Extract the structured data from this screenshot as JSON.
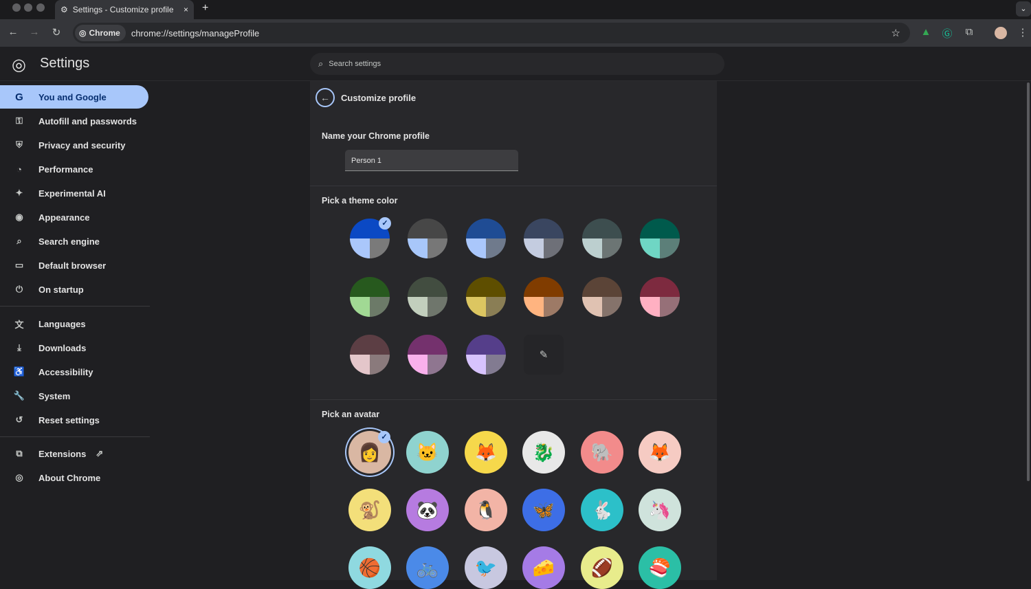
{
  "tab": {
    "title": "Settings - Customize profile",
    "close": "×",
    "new_tab": "+"
  },
  "toolbar": {
    "chip": "Chrome",
    "url": "chrome://settings/manageProfile"
  },
  "header": {
    "title": "Settings",
    "search_placeholder": "Search settings"
  },
  "sidebar": {
    "items": [
      {
        "label": "You and Google",
        "icon": "G"
      },
      {
        "label": "Autofill and passwords",
        "icon": "⚿"
      },
      {
        "label": "Privacy and security",
        "icon": "⛨"
      },
      {
        "label": "Performance",
        "icon": "◔"
      },
      {
        "label": "Experimental AI",
        "icon": "✦"
      },
      {
        "label": "Appearance",
        "icon": "◉"
      },
      {
        "label": "Search engine",
        "icon": "⌕"
      },
      {
        "label": "Default browser",
        "icon": "▭"
      },
      {
        "label": "On startup",
        "icon": "⏻"
      },
      {
        "label": "Languages",
        "icon": "文"
      },
      {
        "label": "Downloads",
        "icon": "⤓"
      },
      {
        "label": "Accessibility",
        "icon": "♿"
      },
      {
        "label": "System",
        "icon": "🔧"
      },
      {
        "label": "Reset settings",
        "icon": "↺"
      },
      {
        "label": "Extensions",
        "icon": "⧉"
      },
      {
        "label": "About Chrome",
        "icon": "◎"
      }
    ]
  },
  "main": {
    "title": "Customize profile",
    "name_label": "Name your Chrome profile",
    "name_value": "Person 1",
    "theme_label": "Pick a theme color",
    "avatar_label": "Pick an avatar",
    "themes": [
      [
        "#0b49c4",
        "#aac7fb",
        "#7a7a7a"
      ],
      [
        "#474747",
        "#a8c7fa",
        "#777777"
      ],
      [
        "#1f4c94",
        "#aac7fb",
        "#6f7a8c"
      ],
      [
        "#3a4660",
        "#c4cce0",
        "#6e7078"
      ],
      [
        "#3d4e4f",
        "#bccfcf",
        "#6c7574"
      ],
      [
        "#005a4c",
        "#6fd6c4",
        "#5c7f79"
      ],
      [
        "#27591e",
        "#a1d994",
        "#6c7a68"
      ],
      [
        "#424d40",
        "#c2cfbd",
        "#6f766c"
      ],
      [
        "#5e4e00",
        "#dcc661",
        "#8a7e55"
      ],
      [
        "#803c00",
        "#ffb480",
        "#9d7a66"
      ],
      [
        "#5b4437",
        "#e0c2b2",
        "#85736b"
      ],
      [
        "#7d2a3f",
        "#ffb0c2",
        "#967078"
      ],
      [
        "#5c3e44",
        "#e4c6ca",
        "#8a7a7c"
      ],
      [
        "#74316d",
        "#f9b0ec",
        "#8f7690"
      ],
      [
        "#553e8a",
        "#d7c3fd",
        "#827b91"
      ]
    ],
    "avatars": [
      [
        "#d9b7a3",
        "👩"
      ],
      [
        "#8fd3cf",
        "🐱"
      ],
      [
        "#f6d84b",
        "🦊"
      ],
      [
        "#e8e8e8",
        "🐉"
      ],
      [
        "#f28b8b",
        "🐘"
      ],
      [
        "#f6cbc3",
        "🦊"
      ],
      [
        "#f3df7a",
        "🐒"
      ],
      [
        "#b67be0",
        "🐼"
      ],
      [
        "#f2b4a6",
        "🐧"
      ],
      [
        "#3d6ee6",
        "🦋"
      ],
      [
        "#2cc0c9",
        "🐇"
      ],
      [
        "#cfe3dc",
        "🦄"
      ],
      [
        "#8fd9e0",
        "🏀"
      ],
      [
        "#4b8ae8",
        "🚲"
      ],
      [
        "#c8c8e0",
        "🐦"
      ],
      [
        "#a57be6",
        "🧀"
      ],
      [
        "#e8ec8c",
        "🏈"
      ],
      [
        "#2bbfa6",
        "🍣"
      ]
    ]
  }
}
